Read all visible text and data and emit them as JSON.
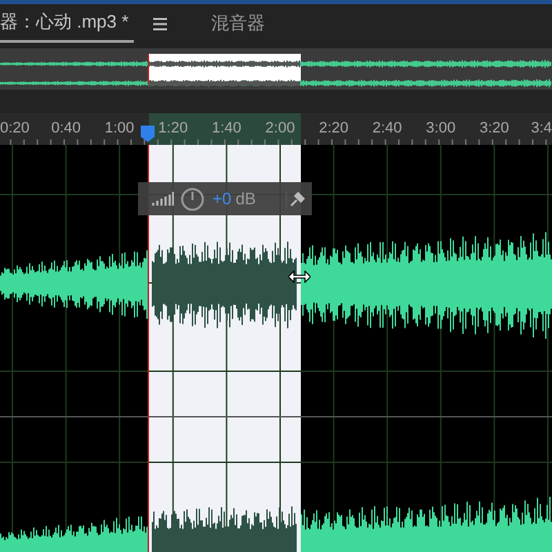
{
  "tabs": [
    {
      "label": "器：心动 .mp3 *",
      "selected": true
    },
    {
      "label": "混音器",
      "selected": false
    }
  ],
  "ruler": {
    "labels": [
      "0:20",
      "0:40",
      "1:00",
      "1:20",
      "1:40",
      "2:00",
      "2:20",
      "2:40",
      "3:00",
      "3:20",
      "3:4"
    ]
  },
  "hud": {
    "value": "+0",
    "unit": "dB"
  }
}
